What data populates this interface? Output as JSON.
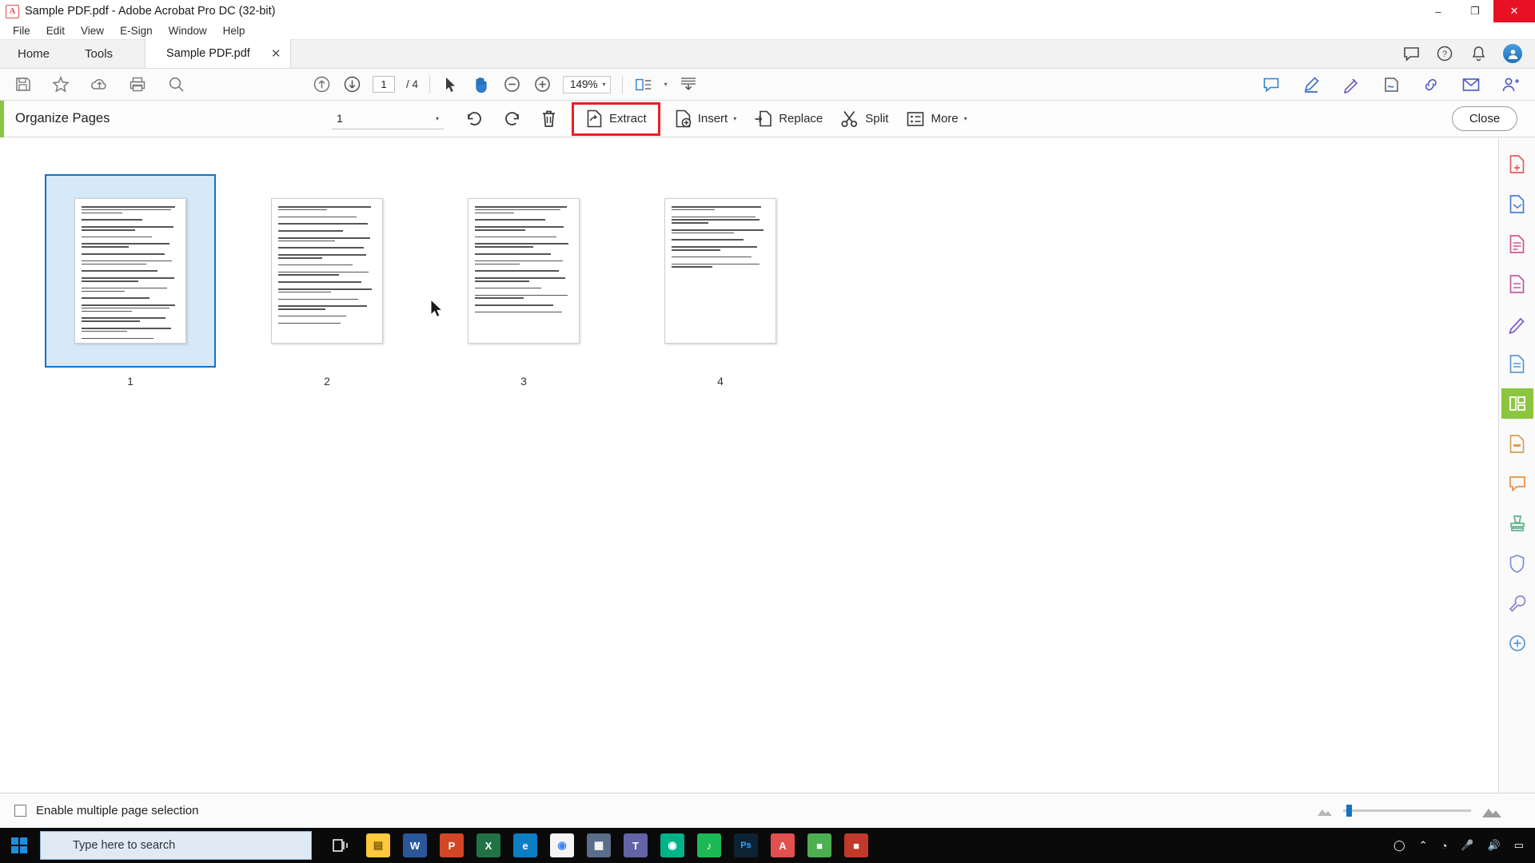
{
  "window": {
    "title": "Sample PDF.pdf - Adobe Acrobat Pro DC (32-bit)",
    "app_icon": "acrobat-icon",
    "minimize": "–",
    "maximize": "❐",
    "close": "✕"
  },
  "menu": {
    "items": [
      {
        "label": "File"
      },
      {
        "label": "Edit"
      },
      {
        "label": "View"
      },
      {
        "label": "E-Sign"
      },
      {
        "label": "Window"
      },
      {
        "label": "Help"
      }
    ]
  },
  "tabs": {
    "home": "Home",
    "tools": "Tools",
    "document": "Sample PDF.pdf",
    "close_glyph": "✕",
    "right_icons": [
      {
        "name": "comment-balloon-icon",
        "glyph": "💬"
      },
      {
        "name": "help-circle-icon",
        "glyph": "?"
      },
      {
        "name": "notification-bell-icon",
        "glyph": "🔔"
      },
      {
        "name": "account-avatar",
        "glyph": "●"
      }
    ]
  },
  "toolbar": {
    "left_icons": [
      {
        "name": "save-icon",
        "glyph": "💾"
      },
      {
        "name": "star-bookmark-icon",
        "glyph": "☆"
      },
      {
        "name": "upload-cloud-icon",
        "glyph": "☁"
      },
      {
        "name": "print-icon",
        "glyph": "🖨"
      },
      {
        "name": "search-icon",
        "glyph": "🔍"
      }
    ],
    "page_up": "↑",
    "page_down": "↓",
    "page_current": "1",
    "page_total": "/ 4",
    "select_tool": "➤",
    "hand_tool": "✋",
    "zoom_out": "−",
    "zoom_in": "+",
    "zoom_level": "149%",
    "zoom_caret": "▾",
    "fit_page": "❐",
    "fit_caret": "▾",
    "scroll_mode": "⬇",
    "right_icons": [
      {
        "name": "comment-icon",
        "glyph": "💬"
      },
      {
        "name": "highlight-pen-icon",
        "glyph": "✎"
      },
      {
        "name": "draw-markup-icon",
        "glyph": "✒"
      },
      {
        "name": "fill-sign-icon",
        "glyph": "🖊"
      },
      {
        "name": "share-link-icon",
        "glyph": "🔗"
      },
      {
        "name": "email-icon",
        "glyph": "✉"
      },
      {
        "name": "add-person-icon",
        "glyph": "👤"
      }
    ]
  },
  "organize": {
    "title": "Organize Pages",
    "page_select_value": "1",
    "page_select_caret": "▾",
    "actions": [
      {
        "name": "rotate-counterclockwise-button",
        "label": "",
        "icon": "↺"
      },
      {
        "name": "rotate-clockwise-button",
        "label": "",
        "icon": "↻"
      },
      {
        "name": "delete-pages-button",
        "label": "",
        "icon": "🗑"
      },
      {
        "name": "extract-button",
        "label": "Extract",
        "icon": "extract-icon",
        "highlighted": true
      },
      {
        "name": "insert-button",
        "label": "Insert",
        "icon": "insert-icon",
        "caret": "▾"
      },
      {
        "name": "replace-button",
        "label": "Replace",
        "icon": "replace-icon"
      },
      {
        "name": "split-button",
        "label": "Split",
        "icon": "scissors-icon"
      },
      {
        "name": "more-button",
        "label": "More",
        "icon": "list-icon",
        "caret": "▾"
      }
    ],
    "close_label": "Close",
    "highlight_color": "#ee1c25",
    "accent_color": "#8cc63e"
  },
  "pages": [
    {
      "number": "1",
      "selected": true
    },
    {
      "number": "2",
      "selected": false
    },
    {
      "number": "3",
      "selected": false
    },
    {
      "number": "4",
      "selected": false
    }
  ],
  "rail": {
    "items": [
      {
        "name": "create-pdf-icon",
        "glyph": "📄",
        "color": "#e35d5d",
        "active": false
      },
      {
        "name": "combine-files-icon",
        "glyph": "🗂",
        "color": "#4a7fd4",
        "active": false
      },
      {
        "name": "export-pdf-icon",
        "glyph": "📑",
        "color": "#d4578a",
        "active": false
      },
      {
        "name": "edit-pdf-icon",
        "glyph": "📝",
        "color": "#c05a9e",
        "active": false
      },
      {
        "name": "sign-icon",
        "glyph": "✏",
        "color": "#7a5ad4",
        "active": false
      },
      {
        "name": "protect-icon",
        "glyph": "📃",
        "color": "#5a9ad4",
        "active": false
      },
      {
        "name": "organize-pages-icon",
        "glyph": "▦",
        "color": "#ffffff",
        "active": true
      },
      {
        "name": "redact-icon",
        "glyph": "📄",
        "color": "#d4a05a",
        "active": false
      },
      {
        "name": "comment-rail-icon",
        "glyph": "💬",
        "color": "#e3924a",
        "active": false
      },
      {
        "name": "stamp-icon",
        "glyph": "🏛",
        "color": "#5ab48a",
        "active": false
      },
      {
        "name": "protect-shield-icon",
        "glyph": "🛡",
        "color": "#7a8fd4",
        "active": false
      },
      {
        "name": "optimize-tools-icon",
        "glyph": "🔧",
        "color": "#8a7fd4",
        "active": false
      },
      {
        "name": "more-tools-icon",
        "glyph": "⊕",
        "color": "#5a9ad4",
        "active": false
      }
    ]
  },
  "status": {
    "checkbox_label": "Enable multiple page selection",
    "checked": false,
    "thumb_small_icon": "small-thumbnail-icon",
    "thumb_large_icon": "large-thumbnail-icon"
  },
  "taskbar": {
    "start_icon": "windows-start-icon",
    "search_placeholder": "Type here to search",
    "task_view_icon": "task-view-icon",
    "apps": [
      {
        "name": "file-explorer-icon",
        "glyph": "📁",
        "color": "#ffc83d"
      },
      {
        "name": "word-icon",
        "glyph": "W",
        "color": "#2b579a"
      },
      {
        "name": "powerpoint-icon",
        "glyph": "P",
        "color": "#d24726"
      },
      {
        "name": "excel-icon",
        "glyph": "X",
        "color": "#217346"
      },
      {
        "name": "edge-icon",
        "glyph": "e",
        "color": "#0b7ec4"
      },
      {
        "name": "chrome-icon",
        "glyph": "◯",
        "color": "#4285f4"
      },
      {
        "name": "calculator-icon",
        "glyph": "⊞",
        "color": "#5a6d8a"
      },
      {
        "name": "teams-icon",
        "glyph": "👥",
        "color": "#6264a7"
      },
      {
        "name": "messenger-icon",
        "glyph": "◉",
        "color": "#00b388"
      },
      {
        "name": "spotify-icon",
        "glyph": "♫",
        "color": "#1db954"
      },
      {
        "name": "photoshop-icon",
        "glyph": "Ps",
        "color": "#31a8ff"
      },
      {
        "name": "acrobat-taskbar-icon",
        "glyph": "A",
        "color": "#e34f4f"
      },
      {
        "name": "sublime-icon",
        "glyph": "■",
        "color": "#4caf50"
      },
      {
        "name": "app-icon",
        "glyph": "■",
        "color": "#c0392b"
      }
    ],
    "tray": [
      {
        "name": "cortana-icon",
        "glyph": "◯"
      },
      {
        "name": "show-hidden-icons",
        "glyph": "⌃"
      },
      {
        "name": "wifi-icon",
        "glyph": "◔"
      },
      {
        "name": "microphone-icon",
        "glyph": "🎤"
      },
      {
        "name": "volume-icon",
        "glyph": "🔊"
      },
      {
        "name": "action-center-icon",
        "glyph": "□"
      }
    ]
  }
}
